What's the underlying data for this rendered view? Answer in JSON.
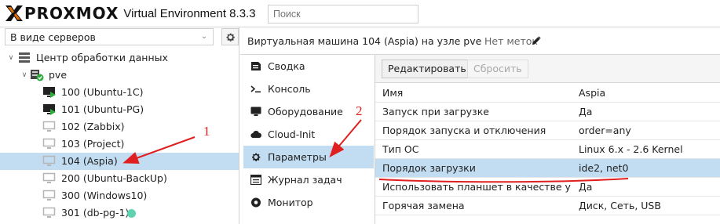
{
  "topbar": {
    "logo_text": "PROXMOX",
    "logo_subtitle": "Virtual Environment 8.3.3",
    "search_placeholder": "Поиск"
  },
  "left": {
    "view_select": "В виде серверов",
    "tree": [
      {
        "label": "Центр обработки данных",
        "icon": "datacenter-icon",
        "level": 0,
        "expanded": true
      },
      {
        "label": "pve",
        "icon": "node-icon",
        "level": 1,
        "expanded": true
      },
      {
        "label": "100 (Ubuntu-1C)",
        "icon": "vm-running-icon",
        "level": 2
      },
      {
        "label": "101 (Ubuntu-PG)",
        "icon": "vm-running-icon",
        "level": 2
      },
      {
        "label": "102 (Zabbix)",
        "icon": "vm-stopped-icon",
        "level": 2
      },
      {
        "label": "103 (Project)",
        "icon": "vm-stopped-icon",
        "level": 2
      },
      {
        "label": "104 (Aspia)",
        "icon": "vm-stopped-icon",
        "level": 2,
        "selected": true
      },
      {
        "label": "200 (Ubuntu-BackUp)",
        "icon": "vm-stopped-icon",
        "level": 2
      },
      {
        "label": "300 (Windows10)",
        "icon": "vm-stopped-icon",
        "level": 2
      },
      {
        "label": "301 (db-pg-1)",
        "icon": "vm-stopped-icon",
        "level": 2,
        "tag_color": "#5fd3b0"
      }
    ]
  },
  "vm": {
    "title": "Виртуальная машина 104 (Aspia) на узле pve",
    "tags": "Нет меток"
  },
  "nav": [
    {
      "label": "Сводка",
      "icon": "summary-icon"
    },
    {
      "label": "Консоль",
      "icon": "console-icon"
    },
    {
      "label": "Оборудование",
      "icon": "hardware-icon"
    },
    {
      "label": "Cloud-Init",
      "icon": "cloud-icon"
    },
    {
      "label": "Параметры",
      "icon": "gear-icon",
      "active": true
    },
    {
      "label": "Журнал задач",
      "icon": "task-log-icon"
    },
    {
      "label": "Монитор",
      "icon": "monitor-icon"
    }
  ],
  "toolbar": {
    "edit_label": "Редактировать",
    "reset_label": "Сбросить"
  },
  "options": [
    {
      "key": "Имя",
      "value": "Aspia"
    },
    {
      "key": "Запуск при загрузке",
      "value": "Да"
    },
    {
      "key": "Порядок запуска и отключения",
      "value": "order=any"
    },
    {
      "key": "Тип ОС",
      "value": "Linux 6.x - 2.6 Kernel"
    },
    {
      "key": "Порядок загрузки",
      "value": "ide2, net0",
      "selected": true
    },
    {
      "key": "Использовать планшет в качестве указателя",
      "value": "Да"
    },
    {
      "key": "Горячая замена",
      "value": "Диск, Сеть, USB"
    }
  ],
  "annotations": {
    "label_1": "1",
    "label_2": "2",
    "color": "#e02020"
  }
}
